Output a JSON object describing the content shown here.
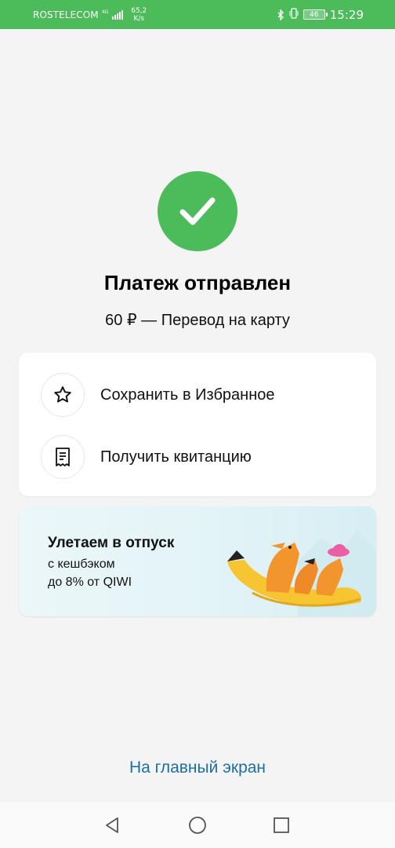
{
  "status_bar": {
    "carrier": "ROSTELECOM",
    "network_tag": "4G",
    "speed_value": "65,2",
    "speed_unit": "K/s",
    "battery": "46",
    "time": "15:29"
  },
  "payment": {
    "title": "Платеж отправлен",
    "subtitle": "60 ₽ — Перевод на карту"
  },
  "actions": [
    {
      "label": "Сохранить в Избранное",
      "icon": "star-icon"
    },
    {
      "label": "Получить квитанцию",
      "icon": "receipt-icon"
    }
  ],
  "promo": {
    "title": "Улетаем в отпуск",
    "line1": "с кешбэком",
    "line2": "до 8% от QIWI"
  },
  "home_link": "На главный экран",
  "colors": {
    "accent_green": "#4cbb5a",
    "link_blue": "#1d6fa5",
    "background": "#f4f4f4"
  }
}
